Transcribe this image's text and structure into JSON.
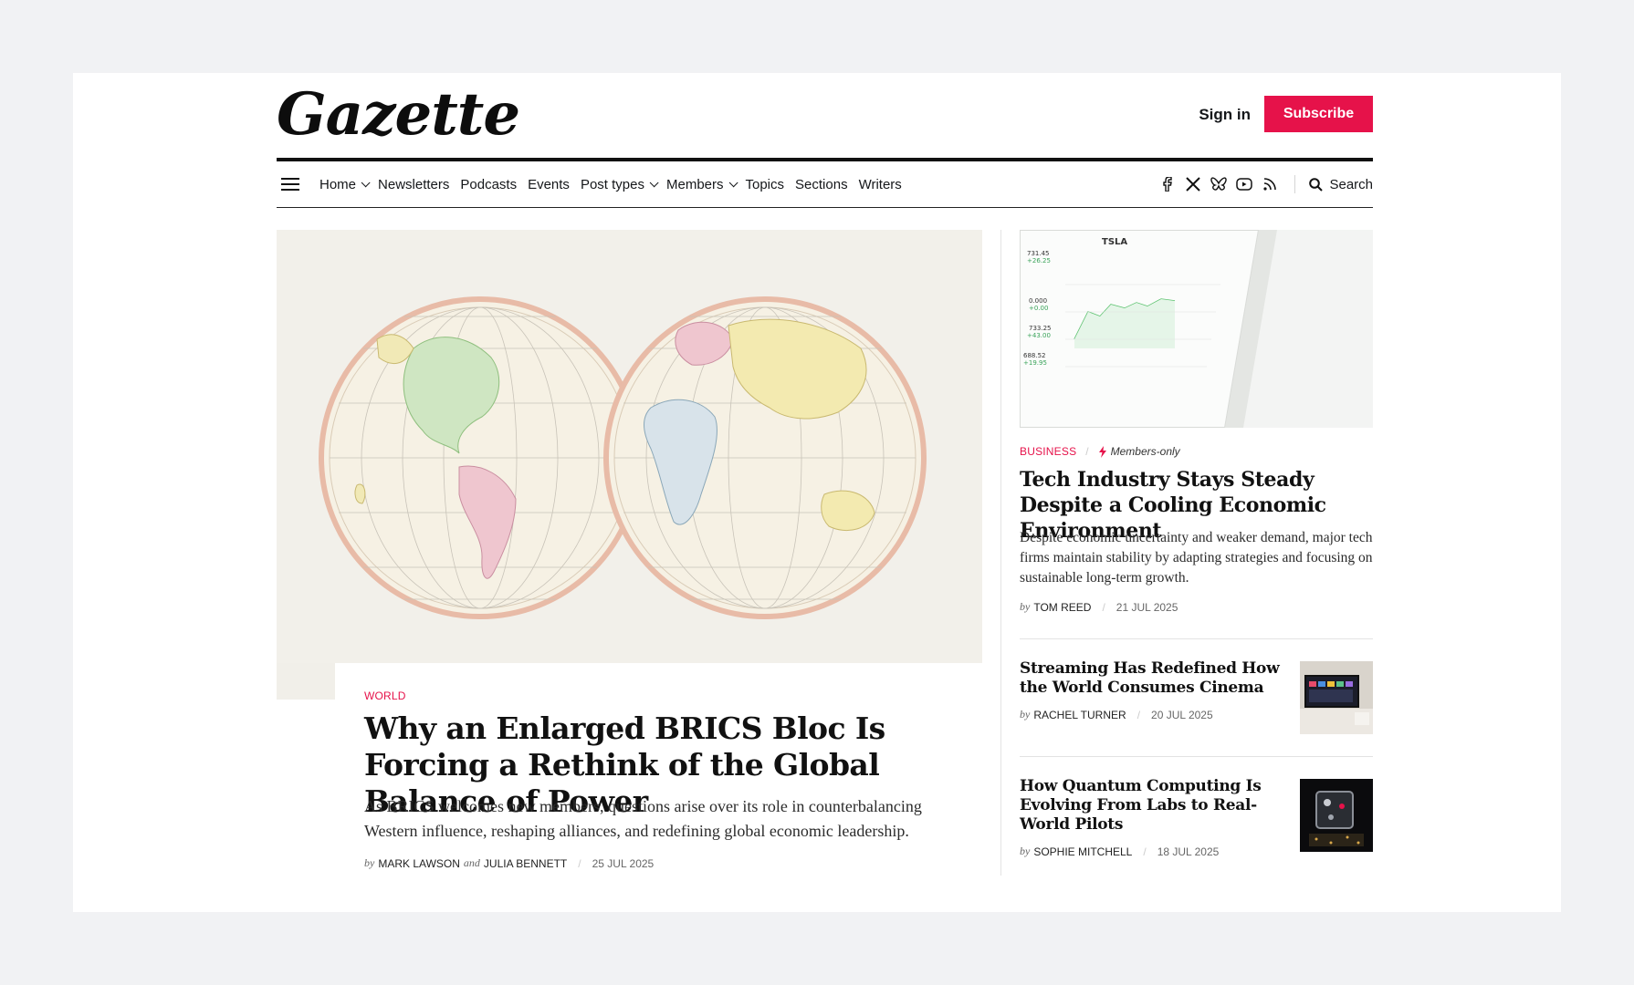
{
  "header": {
    "logo": "Gazette",
    "signin_label": "Sign in",
    "subscribe_label": "Subscribe"
  },
  "nav": {
    "items": [
      {
        "label": "Home",
        "dropdown": true
      },
      {
        "label": "Newsletters",
        "dropdown": false
      },
      {
        "label": "Podcasts",
        "dropdown": false
      },
      {
        "label": "Events",
        "dropdown": false
      },
      {
        "label": "Post types",
        "dropdown": true
      },
      {
        "label": "Members",
        "dropdown": true
      },
      {
        "label": "Topics",
        "dropdown": false
      },
      {
        "label": "Sections",
        "dropdown": false
      },
      {
        "label": "Writers",
        "dropdown": false
      }
    ],
    "social_icons": [
      "facebook-icon",
      "x-icon",
      "bluesky-icon",
      "youtube-icon",
      "rss-icon"
    ],
    "search_label": "Search"
  },
  "featured": {
    "tag": "World",
    "title": "Why an Enlarged BRICS Bloc Is Forcing a Rethink of the Global Balance of Power",
    "excerpt": "As BRICS welcomes new members, questions arise over its role in counterbalancing Western influence, reshaping alliances, and redefining global economic leadership.",
    "by": "by",
    "author1": "Mark Lawson",
    "and": "and",
    "author2": "Julia Bennett",
    "date": "25 Jul 2025"
  },
  "side_main": {
    "tag": "Business",
    "members_label": "Members-only",
    "title": "Tech Industry Stays Steady Despite a Cooling Economic Environment",
    "excerpt": "Despite economic uncertainty and weaker demand, major tech firms maintain stability by adapting strategies and focusing on sustainable long-term growth.",
    "by": "by",
    "author": "Tom Reed",
    "date": "21 Jul 2025"
  },
  "side_list": [
    {
      "title": "Streaming Has Redefined How the World Consumes Cinema",
      "by": "by",
      "author": "Rachel Turner",
      "date": "20 Jul 2025"
    },
    {
      "title": "How Quantum Computing Is Evolving From Labs to Real-World Pilots",
      "by": "by",
      "author": "Sophie Mitchell",
      "date": "18 Jul 2025"
    }
  ],
  "colors": {
    "accent": "#e6124a",
    "text": "#15171a",
    "background": "#f1f2f4"
  }
}
